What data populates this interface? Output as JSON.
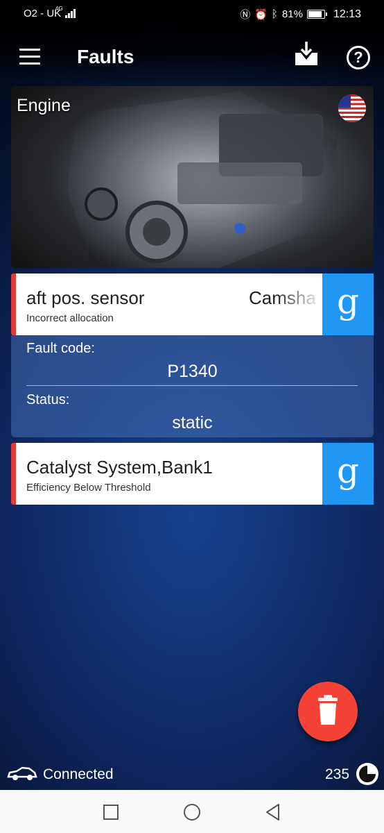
{
  "status_bar": {
    "carrier": "O2 - UK",
    "network": "4G",
    "battery": "81%",
    "time": "12:13"
  },
  "toolbar": {
    "title": "Faults",
    "icons": [
      "menu-icon",
      "download-icon",
      "help-icon"
    ]
  },
  "engine": {
    "label": "Engine",
    "flag": "us-flag-icon"
  },
  "faults": [
    {
      "name_part_a": "aft pos. sensor",
      "name_part_b": "Camsha",
      "description": "Incorrect allocation",
      "search_glyph": "g",
      "details": {
        "code_label": "Fault code:",
        "code": "P1340",
        "status_label": "Status:",
        "status": "static"
      }
    },
    {
      "name": "Catalyst System,Bank1",
      "description": "Efficiency Below Threshold",
      "search_glyph": "g"
    }
  ],
  "connection": {
    "status": "Connected",
    "count": "235"
  },
  "colors": {
    "fault_marker": "#e53935",
    "google_button": "#2196f3",
    "fab": "#f44336"
  }
}
